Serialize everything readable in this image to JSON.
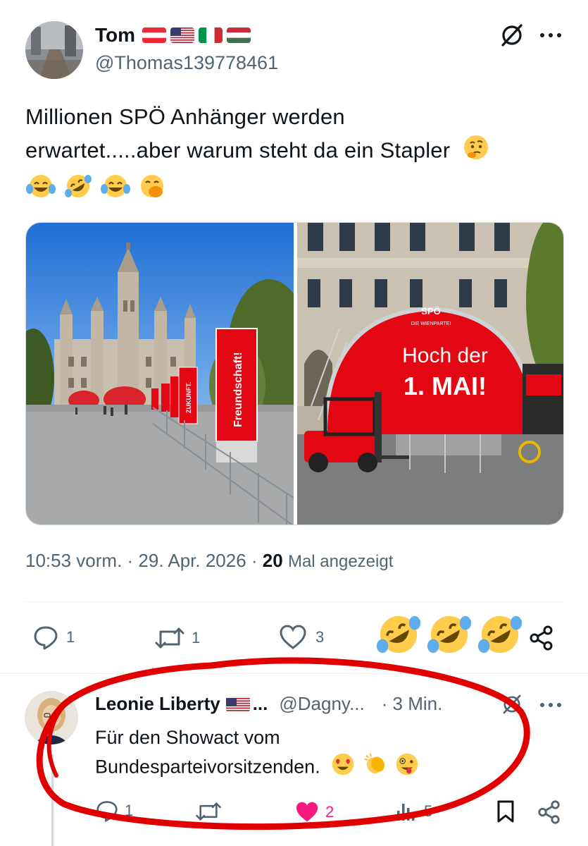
{
  "post": {
    "author_name": "Tom",
    "author_handle": "@Thomas139778461",
    "flags": [
      "austria-flag",
      "usa-flag",
      "italy-flag",
      "hungary-flag"
    ],
    "text_line1": "Millionen SPÖ Anhänger werden",
    "text_line2": "erwartet.....aber warum steht da ein Stapler",
    "emojis": [
      "thinking-face",
      "face-with-tears-of-joy",
      "rolling-on-floor-laughing",
      "face-with-tears-of-joy",
      "face-with-hand-over-mouth"
    ],
    "image_left": {
      "banner_label": "Freundschaft!",
      "small_banner_label": "ZUKUNFT."
    },
    "image_right": {
      "logo": "SPÖ",
      "logo_sub": "DIE WIENPARTEI",
      "headline_line1": "Hoch der",
      "headline_line2": "1. MAI!"
    },
    "time": "10:53 vorm.",
    "date": "29. Apr. 2026",
    "views_count": "20",
    "views_label": "Mal angezeigt",
    "replies": "1",
    "reposts": "1",
    "likes": "3",
    "overlay_emojis": [
      "rolling-on-floor-laughing",
      "rolling-on-floor-laughing",
      "rolling-on-floor-laughing"
    ]
  },
  "reply": {
    "author_name": "Leonie Liberty",
    "flag": "usa-flag",
    "ellipsis": "...",
    "handle": "@Dagny...",
    "time": "· 3 Min.",
    "text_line1": "Für den Showact vom",
    "text_line2": "Bundesparteivorsitzenden.",
    "emojis": [
      "smiling-face-with-heart-eyes",
      "clapping-hands",
      "zany-face"
    ],
    "replies": "1",
    "likes": "2",
    "views": "5"
  },
  "colors": {
    "text": "#0f1419",
    "muted": "#536471",
    "like_pink": "#f91880",
    "annotation_red": "#e00000",
    "spo_red": "#e30613"
  }
}
